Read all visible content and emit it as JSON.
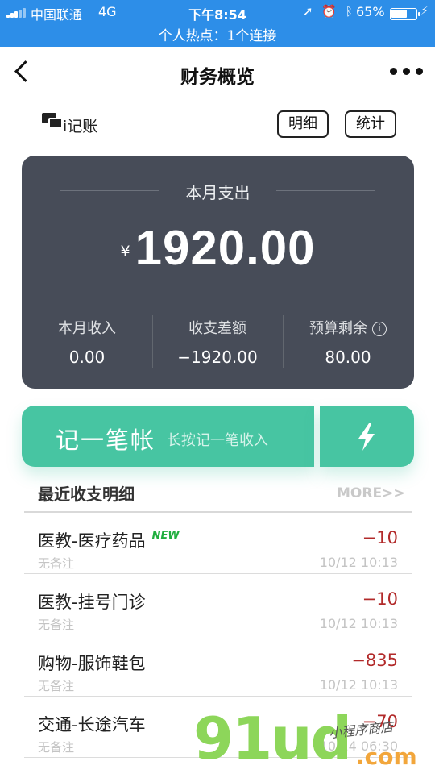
{
  "status_bar": {
    "carrier": "中国联通",
    "network": "4G",
    "time": "下午8:54",
    "battery_percent_text": "65%",
    "battery_level": 0.65,
    "hotspot_text": "个人热点：1个连接",
    "bg_color": "#2d8ee8"
  },
  "nav": {
    "title": "财务概览",
    "back_icon": "chevron-left-icon",
    "more_icon": "more-dots-icon"
  },
  "toolbar": {
    "brand_label": "i记账",
    "detail_label": "明细",
    "stats_label": "统计"
  },
  "summary": {
    "title": "本月支出",
    "currency": "¥",
    "amount": "1920.00",
    "stats": [
      {
        "label": "本月收入",
        "value": "0.00"
      },
      {
        "label": "收支差额",
        "value": "−1920.00"
      },
      {
        "label": "预算剩余",
        "value": "80.00"
      }
    ],
    "bg_color": "#474c58"
  },
  "record": {
    "label": "记一笔帐",
    "hint": "长按记一笔收入",
    "quick_icon": "lightning-bolt-icon",
    "color": "#47c5a2"
  },
  "recent": {
    "title": "最近收支明细",
    "more_label": "MORE>>",
    "items": [
      {
        "category": "医教-医疗药品",
        "badge": "NEW",
        "amount": "−10",
        "note": "无备注",
        "time": "10/12 10:13"
      },
      {
        "category": "医教-挂号门诊",
        "badge": "",
        "amount": "−10",
        "note": "无备注",
        "time": "10/12 10:13"
      },
      {
        "category": "购物-服饰鞋包",
        "badge": "",
        "amount": "−835",
        "note": "无备注",
        "time": "10/12 10:13"
      },
      {
        "category": "交通-长途汽车",
        "badge": "",
        "amount": "−70",
        "note": "无备注",
        "time": "10/14 06:30"
      }
    ],
    "amount_color": "#b22a2a"
  },
  "watermark": {
    "main": "91ud",
    "suffix": ".com",
    "handwriting": "小程序商店"
  }
}
